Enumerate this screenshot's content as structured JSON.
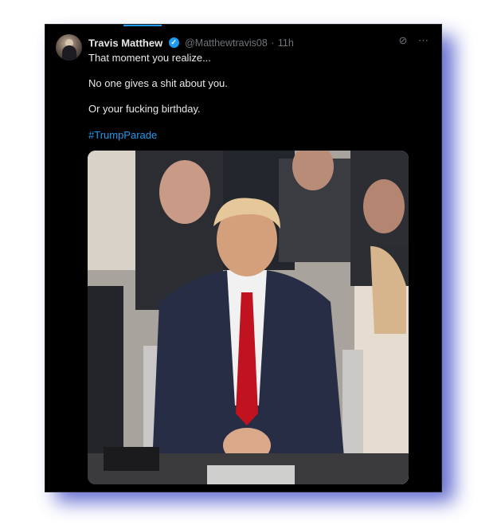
{
  "post": {
    "author_name": "Travis Matthew",
    "handle": "@Matthewtravis08",
    "separator": "·",
    "time": "11h",
    "lines": [
      "That moment you realize...",
      "No one gives a shit about you.",
      "Or your fucking birthday."
    ],
    "hashtag": "#TrumpParade"
  },
  "icons": {
    "verified": "check-badge-icon",
    "grok": "grok-icon",
    "more": "more-icon"
  },
  "colors": {
    "accent": "#1d9bf0",
    "background": "#000000",
    "shadow": "#4a55c8"
  }
}
